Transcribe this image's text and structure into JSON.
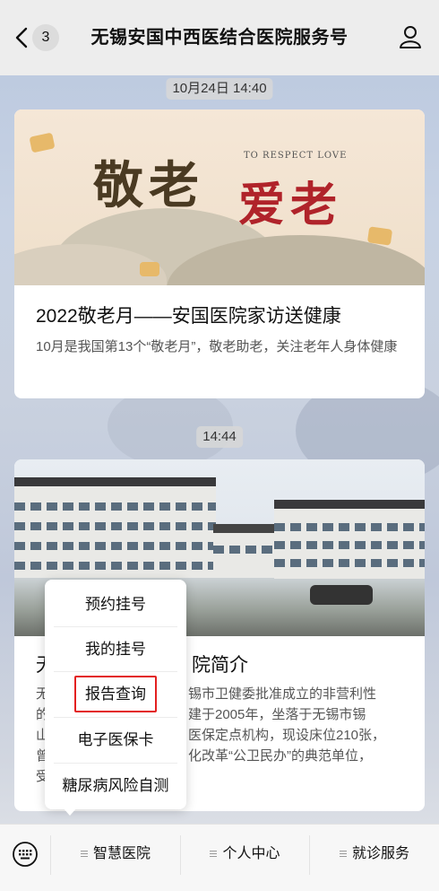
{
  "header": {
    "back_count": "3",
    "title": "无锡安国中西医结合医院服务号"
  },
  "messages": [
    {
      "time": "10月24日 14:40",
      "banner_text_main": "敬老",
      "banner_text_accent": "爱老",
      "banner_text_en": "TO RESPECT LOVE",
      "title": "2022敬老月——安国医院家访送健康",
      "desc": "10月是我国第13个“敬老月”，敬老助老，关注老年人身体健康"
    },
    {
      "time": "14:44",
      "title_prefix": "无",
      "title_suffix": "院简介",
      "lines": [
        {
          "left": "无",
          "right": "锡市卫健委批准成立的非营利性"
        },
        {
          "left": "的",
          "right": "建于2005年，坐落于无锡市锡"
        },
        {
          "left": "山",
          "right": "医保定点机构，现设床位210张，"
        },
        {
          "left": "曾",
          "right": "化改革“公卫民办”的典范单位，"
        },
        {
          "left": "受",
          "right": ""
        }
      ]
    }
  ],
  "popup_menu": {
    "items": [
      "预约挂号",
      "我的挂号",
      "报告查询",
      "电子医保卡",
      "糖尿病风险自测"
    ],
    "highlighted": "报告查询"
  },
  "bottom_menu": {
    "tabs": [
      "智慧医院",
      "个人中心",
      "就诊服务"
    ]
  },
  "colors": {
    "highlight_border": "#e32020",
    "accent_red": "#b0232a"
  },
  "icons": [
    "back-chevron-icon",
    "user-icon",
    "keyboard-icon",
    "menu-lines-icon"
  ]
}
